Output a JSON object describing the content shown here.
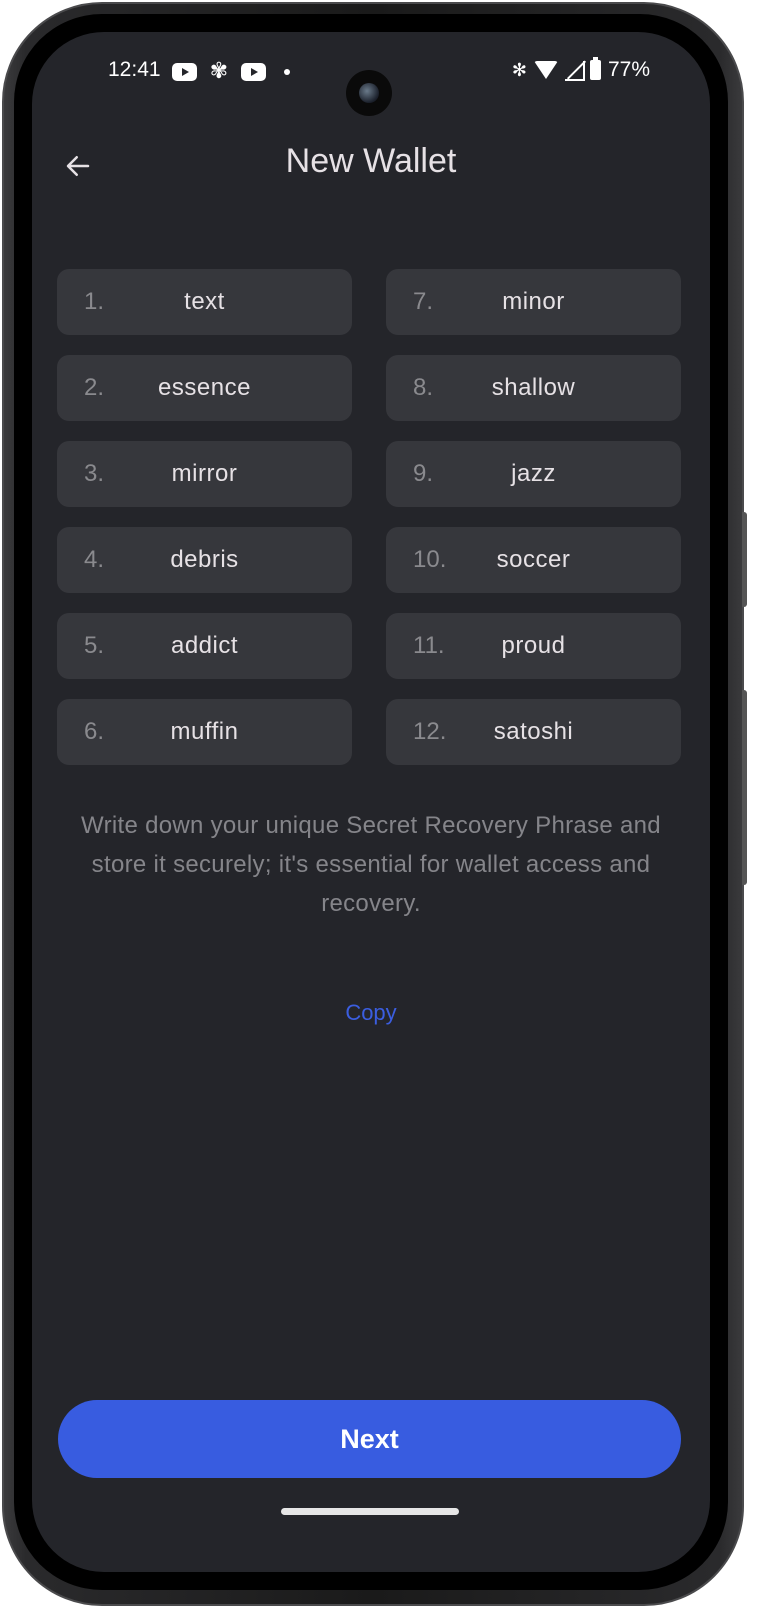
{
  "status_bar": {
    "time": "12:41",
    "left_icons": [
      "youtube-icon",
      "pinwheel-icon",
      "youtube-icon",
      "notification-dot-icon"
    ],
    "right_icons": [
      "bluetooth-icon",
      "wifi-icon",
      "cell-signal-icon",
      "battery-icon"
    ],
    "battery_percent": "77%"
  },
  "header": {
    "back_icon": "arrow-left-icon",
    "title": "New Wallet"
  },
  "recovery_phrase": {
    "words": [
      {
        "index": "1.",
        "word": "text"
      },
      {
        "index": "7.",
        "word": "minor"
      },
      {
        "index": "2.",
        "word": "essence"
      },
      {
        "index": "8.",
        "word": "shallow"
      },
      {
        "index": "3.",
        "word": "mirror"
      },
      {
        "index": "9.",
        "word": "jazz"
      },
      {
        "index": "4.",
        "word": "debris"
      },
      {
        "index": "10.",
        "word": "soccer"
      },
      {
        "index": "5.",
        "word": "addict"
      },
      {
        "index": "11.",
        "word": "proud"
      },
      {
        "index": "6.",
        "word": "muffin"
      },
      {
        "index": "12.",
        "word": "satoshi"
      }
    ]
  },
  "hint_text": "Write down your unique Secret Recovery Phrase and store it securely; it's essential for wallet access and recovery.",
  "copy_label": "Copy",
  "next_label": "Next",
  "colors": {
    "background": "#24252a",
    "card": "#36373c",
    "accent": "#385ce0",
    "link": "#3b5ee0"
  }
}
